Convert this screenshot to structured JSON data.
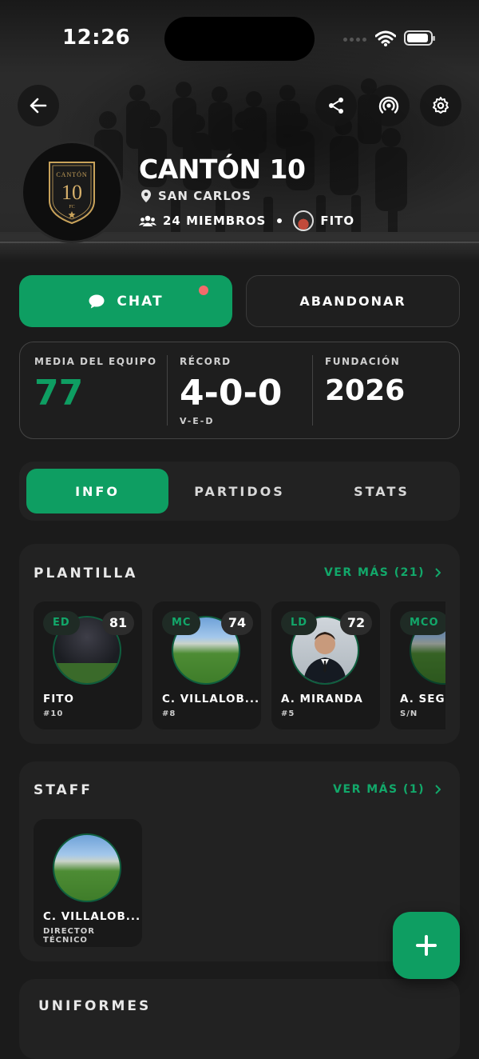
{
  "status_bar": {
    "time": "12:26"
  },
  "header": {
    "team_name": "CANTÓN 10",
    "crest_text": "CANTÓN",
    "crest_number": "10",
    "crest_sub": "FC",
    "location": "SAN CARLOS",
    "members": "24 MIEMBROS",
    "owner": "FITO"
  },
  "actions": {
    "chat_label": "CHAT",
    "leave_label": "ABANDONAR"
  },
  "stats": {
    "team_avg_label": "MEDIA DEL EQUIPO",
    "team_avg_value": "77",
    "record_label": "RÉCORD",
    "record_value": "4-0-0",
    "record_sub": "V-E-D",
    "founded_label": "FUNDACIÓN",
    "founded_value": "2026"
  },
  "tabs": [
    {
      "label": "INFO",
      "active": true
    },
    {
      "label": "PARTIDOS",
      "active": false
    },
    {
      "label": "STATS",
      "active": false
    }
  ],
  "squad": {
    "title": "PLANTILLA",
    "see_more": "VER MÁS (21)",
    "players": [
      {
        "pos": "ED",
        "rating": "81",
        "name": "FITO",
        "number": "#10"
      },
      {
        "pos": "MC",
        "rating": "74",
        "name": "C. VILLALOB...",
        "number": "#8"
      },
      {
        "pos": "LD",
        "rating": "72",
        "name": "A. MIRANDA",
        "number": "#5"
      },
      {
        "pos": "MCO",
        "rating": "",
        "name": "A. SEGU",
        "number": "S/N"
      }
    ]
  },
  "staff": {
    "title": "STAFF",
    "see_more": "VER MÁS (1)",
    "members": [
      {
        "name": "C. VILLALOB...",
        "role": "DIRECTOR TÉCNICO"
      }
    ]
  },
  "uniforms": {
    "title": "UNIFORMES"
  },
  "colors": {
    "accent": "#0e9e62",
    "accent_text": "#12a86a",
    "background": "#1b1b1b",
    "card": "#222222",
    "notification": "#f36b6b"
  }
}
